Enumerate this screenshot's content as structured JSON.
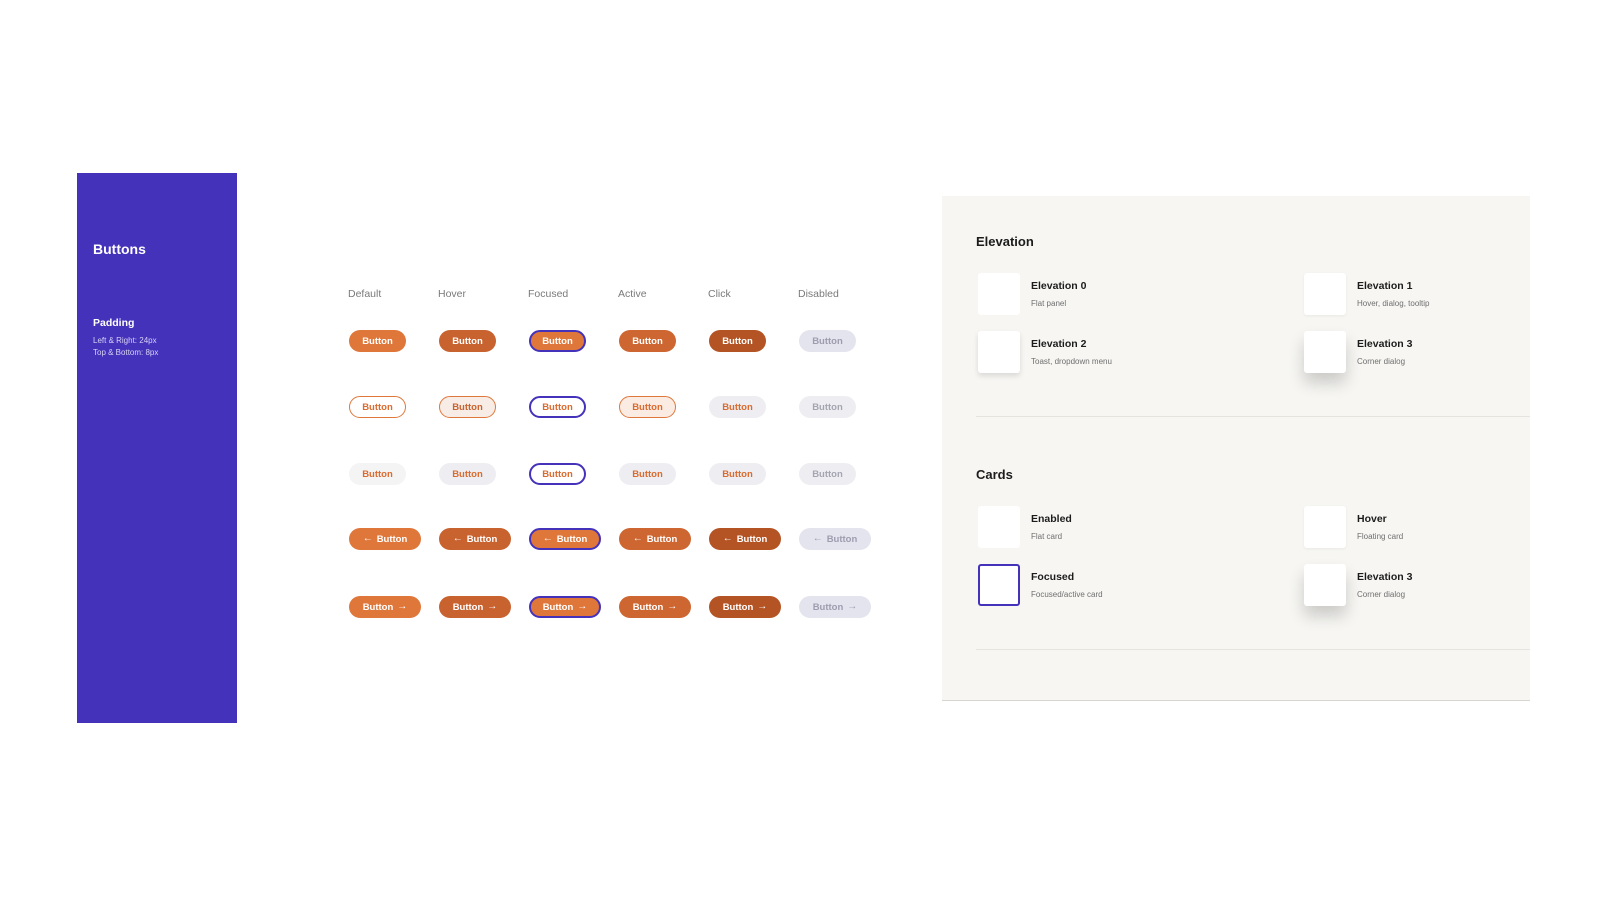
{
  "sidebar": {
    "title": "Buttons",
    "padding_label": "Padding",
    "padding_lr": "Left & Right: 24px",
    "padding_tb": "Top & Bottom: 8px"
  },
  "columns": [
    "Default",
    "Hover",
    "Focused",
    "Active",
    "Click",
    "Disabled"
  ],
  "button_label": "Button",
  "arrow_left_icon": "←",
  "arrow_right_icon": "→",
  "button_rows": [
    {
      "style": "filled"
    },
    {
      "style": "outline"
    },
    {
      "style": "ghost"
    },
    {
      "style": "filled-leading-arrow"
    },
    {
      "style": "filled-trailing-arrow"
    }
  ],
  "colors": {
    "brand": "#4432bb",
    "accent": "#e0773a",
    "accent_hover": "#c8622f",
    "accent_click": "#b45424",
    "disabled_bg": "#e4e4ee",
    "panel_bg": "#f7f6f3"
  },
  "elevation": {
    "title": "Elevation",
    "items": [
      {
        "title": "Elevation 0",
        "subtitle": "Flat panel"
      },
      {
        "title": "Elevation 1",
        "subtitle": "Hover, dialog, tooltip"
      },
      {
        "title": "Elevation 2",
        "subtitle": "Toast, dropdown menu"
      },
      {
        "title": "Elevation 3",
        "subtitle": "Corner dialog"
      }
    ]
  },
  "cards": {
    "title": "Cards",
    "items": [
      {
        "title": "Enabled",
        "subtitle": "Flat card"
      },
      {
        "title": "Hover",
        "subtitle": "Floating card"
      },
      {
        "title": "Focused",
        "subtitle": "Focused/active card"
      },
      {
        "title": "Elevation 3",
        "subtitle": "Corner dialog"
      }
    ]
  }
}
